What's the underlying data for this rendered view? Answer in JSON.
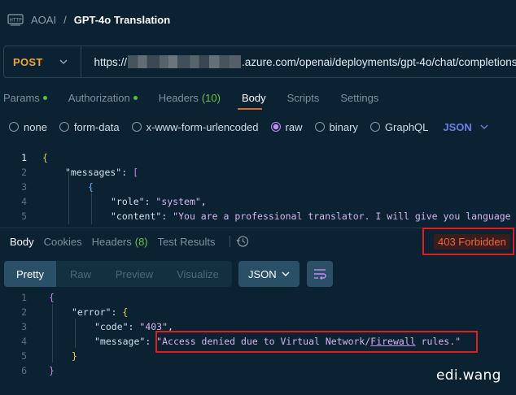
{
  "breadcrumb": {
    "icon": "http-file-icon",
    "parent": "AOAI",
    "separator": "/",
    "title": "GPT-4o Translation"
  },
  "request": {
    "method": "POST",
    "url_prefix": "https://",
    "url_suffix": ".azure.com/openai/deployments/gpt-4o/chat/completions?"
  },
  "request_tabs": [
    {
      "label": "Params",
      "dot": true
    },
    {
      "label": "Authorization",
      "dot": true
    },
    {
      "label": "Headers",
      "count": "(10)"
    },
    {
      "label": "Body",
      "active": true
    },
    {
      "label": "Scripts"
    },
    {
      "label": "Settings"
    }
  ],
  "body_types": [
    {
      "label": "none"
    },
    {
      "label": "form-data"
    },
    {
      "label": "x-www-form-urlencoded"
    },
    {
      "label": "raw",
      "checked": true
    },
    {
      "label": "binary"
    },
    {
      "label": "GraphQL"
    }
  ],
  "body_format": "JSON",
  "request_code": {
    "line_numbers": [
      "1",
      "2",
      "3",
      "4",
      "5"
    ],
    "l1": "{",
    "l2_key": "\"messages\"",
    "l2_colon": ": ",
    "l2_bracket": "[",
    "l3": "{",
    "l4_key": "\"role\"",
    "l4_colon": ": ",
    "l4_val": "\"system\"",
    "l4_comma": ",",
    "l5_key": "\"content\"",
    "l5_colon": ": ",
    "l5_val": "\"You are a professional translator. I will give you language"
  },
  "response_tabs": [
    {
      "label": "Body",
      "active": true
    },
    {
      "label": "Cookies"
    },
    {
      "label": "Headers",
      "count": "(8)"
    },
    {
      "label": "Test Results"
    }
  ],
  "status": "403 Forbidden",
  "view_modes": [
    "Pretty",
    "Raw",
    "Preview",
    "Visualize"
  ],
  "response_format": "JSON",
  "response_code": {
    "line_numbers": [
      "1",
      "2",
      "3",
      "4",
      "5",
      "6"
    ],
    "l1": "{",
    "l2_key": "\"error\"",
    "l2_colon": ": ",
    "l2_brace": "{",
    "l3_key": "\"code\"",
    "l3_colon": ": ",
    "l3_val": "\"403\"",
    "l3_comma": ",",
    "l4_key": "\"message\"",
    "l4_colon": ": ",
    "l4_val_a": "\"Access denied due to Virtual Network/",
    "l4_val_b": "Firewall",
    "l4_val_c": " rules.\"",
    "l5": "}",
    "l6": "}"
  },
  "watermark": "edi.wang",
  "colors": {
    "background": "#0b2232",
    "method": "#f2a53c",
    "status": "#f0673e",
    "highlight": "#e11d24",
    "active_tab_underline": "#e0672c"
  }
}
